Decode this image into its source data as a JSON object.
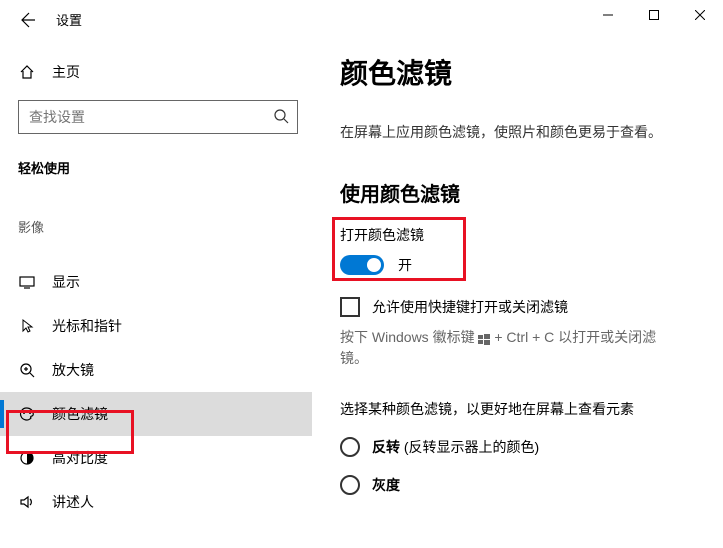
{
  "header": {
    "settings_label": "设置"
  },
  "sidebar": {
    "home_label": "主页",
    "search_placeholder": "查找设置",
    "group_ease": "轻松使用",
    "group_vision": "影像",
    "items": [
      {
        "label": "显示"
      },
      {
        "label": "光标和指针"
      },
      {
        "label": "放大镜"
      },
      {
        "label": "颜色滤镜"
      },
      {
        "label": "高对比度"
      },
      {
        "label": "讲述人"
      }
    ]
  },
  "content": {
    "page_title": "颜色滤镜",
    "page_desc": "在屏幕上应用颜色滤镜，使照片和颜色更易于查看。",
    "section_title": "使用颜色滤镜",
    "toggle_label": "打开颜色滤镜",
    "toggle_state": "开",
    "checkbox_label": "允许使用快捷键打开或关闭滤镜",
    "help_text_prefix": "按下 Windows 徽标键 ",
    "help_text_suffix": " + Ctrl + C 以打开或关闭滤镜。",
    "radio_section_label": "选择某种颜色滤镜，以更好地在屏幕上查看元素",
    "radios": [
      {
        "bold": "反转",
        "rest": " (反转显示器上的颜色)"
      },
      {
        "bold": "灰度",
        "rest": ""
      }
    ]
  }
}
